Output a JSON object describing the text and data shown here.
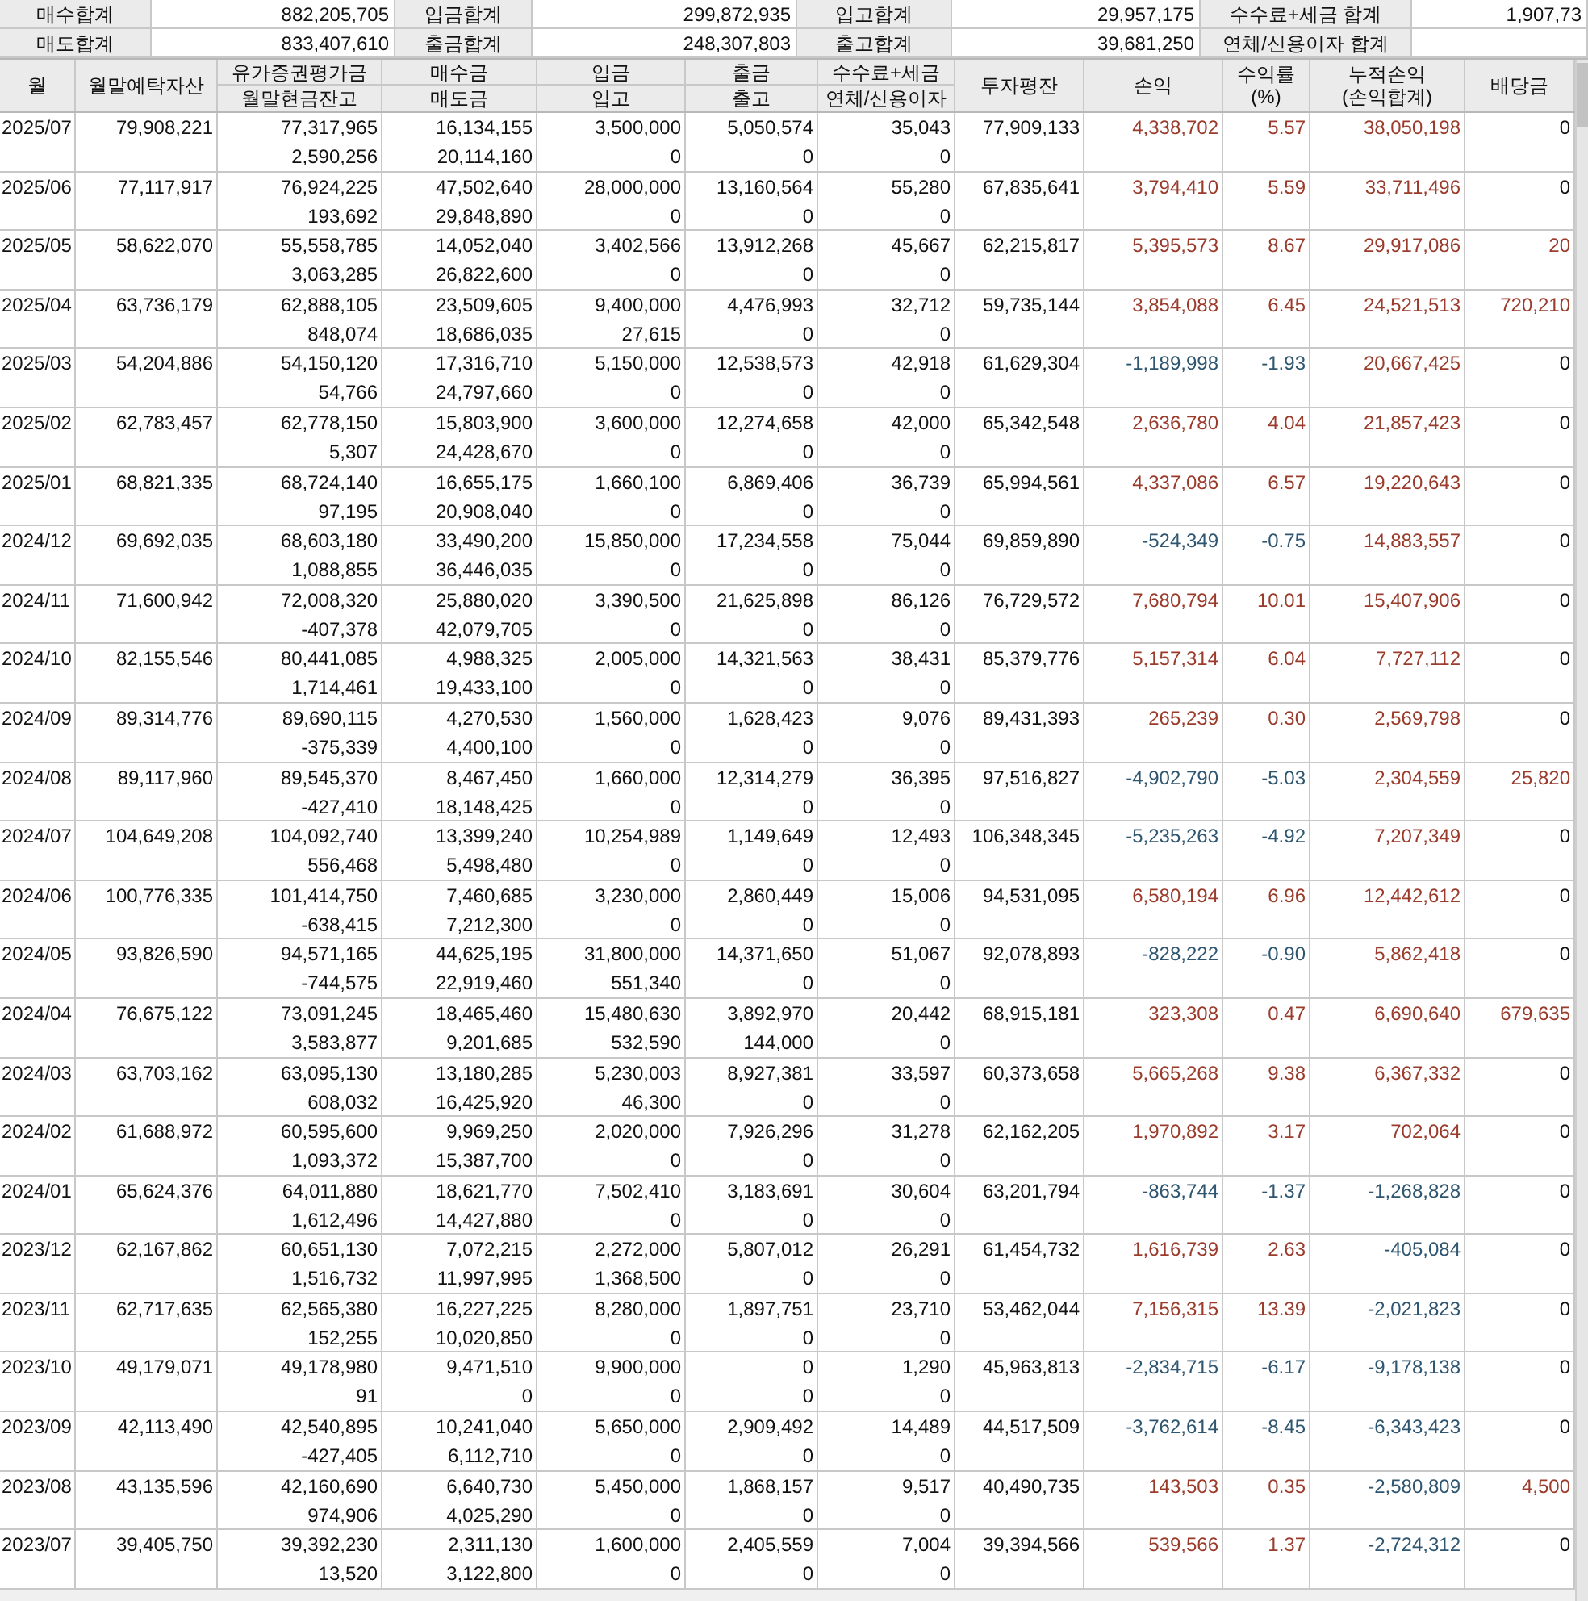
{
  "summary": [
    {
      "label": "매수합계",
      "value": "882,205,705"
    },
    {
      "label": "입금합계",
      "value": "299,872,935"
    },
    {
      "label": "입고합계",
      "value": "29,957,175"
    },
    {
      "label": "수수료+세금 합계",
      "value": "1,907,73"
    },
    {
      "label": "매도합계",
      "value": "833,407,610"
    },
    {
      "label": "출금합계",
      "value": "248,307,803"
    },
    {
      "label": "출고합계",
      "value": "39,681,250"
    },
    {
      "label": "연체/신용이자 합계"
    }
  ],
  "columns": [
    {
      "lines": [
        "월"
      ]
    },
    {
      "lines": [
        "월말예탁자산"
      ]
    },
    {
      "top": "유가증권평가금",
      "bottom": "월말현금잔고"
    },
    {
      "top": "매수금",
      "bottom": "매도금"
    },
    {
      "top": "입금",
      "bottom": "입고"
    },
    {
      "top": "출금",
      "bottom": "출고"
    },
    {
      "top": "수수료+세금",
      "bottom": "연체/신용이자"
    },
    {
      "lines": [
        "투자평잔"
      ]
    },
    {
      "lines": [
        "손익"
      ]
    },
    {
      "lines": [
        "수익률",
        "(%)"
      ]
    },
    {
      "lines": [
        "누적손익",
        "(손익합계)"
      ]
    },
    {
      "lines": [
        "배당금"
      ]
    }
  ],
  "rows": [
    {
      "month": "2025/07",
      "assets": "79,908,221",
      "eval": [
        "77,317,965",
        "2,590,256"
      ],
      "trade": [
        "16,134,155",
        "20,114,160"
      ],
      "deposit": [
        "3,500,000",
        "0"
      ],
      "withdraw": [
        "5,050,574",
        "0"
      ],
      "fees": [
        "35,043",
        "0"
      ],
      "avg_invested": "77,909,133",
      "profit": {
        "text": "4,338,702",
        "color": "#9a3b2b"
      },
      "return_pct": {
        "text": "5.57",
        "color": "#9a3b2b"
      },
      "cumulative": {
        "text": "38,050,198",
        "color": "#9a3b2b"
      },
      "dividend": {
        "text": "0",
        "color": "#111111"
      }
    },
    {
      "month": "2025/06",
      "assets": "77,117,917",
      "eval": [
        "76,924,225",
        "193,692"
      ],
      "trade": [
        "47,502,640",
        "29,848,890"
      ],
      "deposit": [
        "28,000,000",
        "0"
      ],
      "withdraw": [
        "13,160,564",
        "0"
      ],
      "fees": [
        "55,280",
        "0"
      ],
      "avg_invested": "67,835,641",
      "profit": {
        "text": "3,794,410",
        "color": "#9a3b2b"
      },
      "return_pct": {
        "text": "5.59",
        "color": "#9a3b2b"
      },
      "cumulative": {
        "text": "33,711,496",
        "color": "#9a3b2b"
      },
      "dividend": {
        "text": "0",
        "color": "#111111"
      }
    },
    {
      "month": "2025/05",
      "assets": "58,622,070",
      "eval": [
        "55,558,785",
        "3,063,285"
      ],
      "trade": [
        "14,052,040",
        "26,822,600"
      ],
      "deposit": [
        "3,402,566",
        "0"
      ],
      "withdraw": [
        "13,912,268",
        "0"
      ],
      "fees": [
        "45,667",
        "0"
      ],
      "avg_invested": "62,215,817",
      "profit": {
        "text": "5,395,573",
        "color": "#9a3b2b"
      },
      "return_pct": {
        "text": "8.67",
        "color": "#9a3b2b"
      },
      "cumulative": {
        "text": "29,917,086",
        "color": "#9a3b2b"
      },
      "dividend": {
        "text": "20",
        "color": "#9a3b2b"
      }
    },
    {
      "month": "2025/04",
      "assets": "63,736,179",
      "eval": [
        "62,888,105",
        "848,074"
      ],
      "trade": [
        "23,509,605",
        "18,686,035"
      ],
      "deposit": [
        "9,400,000",
        "27,615"
      ],
      "withdraw": [
        "4,476,993",
        "0"
      ],
      "fees": [
        "32,712",
        "0"
      ],
      "avg_invested": "59,735,144",
      "profit": {
        "text": "3,854,088",
        "color": "#9a3b2b"
      },
      "return_pct": {
        "text": "6.45",
        "color": "#9a3b2b"
      },
      "cumulative": {
        "text": "24,521,513",
        "color": "#9a3b2b"
      },
      "dividend": {
        "text": "720,210",
        "color": "#9a3b2b"
      }
    },
    {
      "month": "2025/03",
      "assets": "54,204,886",
      "eval": [
        "54,150,120",
        "54,766"
      ],
      "trade": [
        "17,316,710",
        "24,797,660"
      ],
      "deposit": [
        "5,150,000",
        "0"
      ],
      "withdraw": [
        "12,538,573",
        "0"
      ],
      "fees": [
        "42,918",
        "0"
      ],
      "avg_invested": "61,629,304",
      "profit": {
        "text": "-1,189,998",
        "color": "#2f5670"
      },
      "return_pct": {
        "text": "-1.93",
        "color": "#2f5670"
      },
      "cumulative": {
        "text": "20,667,425",
        "color": "#9a3b2b"
      },
      "dividend": {
        "text": "0",
        "color": "#111111"
      }
    },
    {
      "month": "2025/02",
      "assets": "62,783,457",
      "eval": [
        "62,778,150",
        "5,307"
      ],
      "trade": [
        "15,803,900",
        "24,428,670"
      ],
      "deposit": [
        "3,600,000",
        "0"
      ],
      "withdraw": [
        "12,274,658",
        "0"
      ],
      "fees": [
        "42,000",
        "0"
      ],
      "avg_invested": "65,342,548",
      "profit": {
        "text": "2,636,780",
        "color": "#9a3b2b"
      },
      "return_pct": {
        "text": "4.04",
        "color": "#9a3b2b"
      },
      "cumulative": {
        "text": "21,857,423",
        "color": "#9a3b2b"
      },
      "dividend": {
        "text": "0",
        "color": "#111111"
      }
    },
    {
      "month": "2025/01",
      "assets": "68,821,335",
      "eval": [
        "68,724,140",
        "97,195"
      ],
      "trade": [
        "16,655,175",
        "20,908,040"
      ],
      "deposit": [
        "1,660,100",
        "0"
      ],
      "withdraw": [
        "6,869,406",
        "0"
      ],
      "fees": [
        "36,739",
        "0"
      ],
      "avg_invested": "65,994,561",
      "profit": {
        "text": "4,337,086",
        "color": "#9a3b2b"
      },
      "return_pct": {
        "text": "6.57",
        "color": "#9a3b2b"
      },
      "cumulative": {
        "text": "19,220,643",
        "color": "#9a3b2b"
      },
      "dividend": {
        "text": "0",
        "color": "#111111"
      }
    },
    {
      "month": "2024/12",
      "assets": "69,692,035",
      "eval": [
        "68,603,180",
        "1,088,855"
      ],
      "trade": [
        "33,490,200",
        "36,446,035"
      ],
      "deposit": [
        "15,850,000",
        "0"
      ],
      "withdraw": [
        "17,234,558",
        "0"
      ],
      "fees": [
        "75,044",
        "0"
      ],
      "avg_invested": "69,859,890",
      "profit": {
        "text": "-524,349",
        "color": "#2f5670"
      },
      "return_pct": {
        "text": "-0.75",
        "color": "#2f5670"
      },
      "cumulative": {
        "text": "14,883,557",
        "color": "#9a3b2b"
      },
      "dividend": {
        "text": "0",
        "color": "#111111"
      }
    },
    {
      "month": "2024/11",
      "assets": "71,600,942",
      "eval": [
        "72,008,320",
        "-407,378"
      ],
      "trade": [
        "25,880,020",
        "42,079,705"
      ],
      "deposit": [
        "3,390,500",
        "0"
      ],
      "withdraw": [
        "21,625,898",
        "0"
      ],
      "fees": [
        "86,126",
        "0"
      ],
      "avg_invested": "76,729,572",
      "profit": {
        "text": "7,680,794",
        "color": "#9a3b2b"
      },
      "return_pct": {
        "text": "10.01",
        "color": "#9a3b2b"
      },
      "cumulative": {
        "text": "15,407,906",
        "color": "#9a3b2b"
      },
      "dividend": {
        "text": "0",
        "color": "#111111"
      }
    },
    {
      "month": "2024/10",
      "assets": "82,155,546",
      "eval": [
        "80,441,085",
        "1,714,461"
      ],
      "trade": [
        "4,988,325",
        "19,433,100"
      ],
      "deposit": [
        "2,005,000",
        "0"
      ],
      "withdraw": [
        "14,321,563",
        "0"
      ],
      "fees": [
        "38,431",
        "0"
      ],
      "avg_invested": "85,379,776",
      "profit": {
        "text": "5,157,314",
        "color": "#9a3b2b"
      },
      "return_pct": {
        "text": "6.04",
        "color": "#9a3b2b"
      },
      "cumulative": {
        "text": "7,727,112",
        "color": "#9a3b2b"
      },
      "dividend": {
        "text": "0",
        "color": "#111111"
      }
    },
    {
      "month": "2024/09",
      "assets": "89,314,776",
      "eval": [
        "89,690,115",
        "-375,339"
      ],
      "trade": [
        "4,270,530",
        "4,400,100"
      ],
      "deposit": [
        "1,560,000",
        "0"
      ],
      "withdraw": [
        "1,628,423",
        "0"
      ],
      "fees": [
        "9,076",
        "0"
      ],
      "avg_invested": "89,431,393",
      "profit": {
        "text": "265,239",
        "color": "#9a3b2b"
      },
      "return_pct": {
        "text": "0.30",
        "color": "#9a3b2b"
      },
      "cumulative": {
        "text": "2,569,798",
        "color": "#9a3b2b"
      },
      "dividend": {
        "text": "0",
        "color": "#111111"
      }
    },
    {
      "month": "2024/08",
      "assets": "89,117,960",
      "eval": [
        "89,545,370",
        "-427,410"
      ],
      "trade": [
        "8,467,450",
        "18,148,425"
      ],
      "deposit": [
        "1,660,000",
        "0"
      ],
      "withdraw": [
        "12,314,279",
        "0"
      ],
      "fees": [
        "36,395",
        "0"
      ],
      "avg_invested": "97,516,827",
      "profit": {
        "text": "-4,902,790",
        "color": "#2f5670"
      },
      "return_pct": {
        "text": "-5.03",
        "color": "#2f5670"
      },
      "cumulative": {
        "text": "2,304,559",
        "color": "#9a3b2b"
      },
      "dividend": {
        "text": "25,820",
        "color": "#9a3b2b"
      }
    },
    {
      "month": "2024/07",
      "assets": "104,649,208",
      "eval": [
        "104,092,740",
        "556,468"
      ],
      "trade": [
        "13,399,240",
        "5,498,480"
      ],
      "deposit": [
        "10,254,989",
        "0"
      ],
      "withdraw": [
        "1,149,649",
        "0"
      ],
      "fees": [
        "12,493",
        "0"
      ],
      "avg_invested": "106,348,345",
      "profit": {
        "text": "-5,235,263",
        "color": "#2f5670"
      },
      "return_pct": {
        "text": "-4.92",
        "color": "#2f5670"
      },
      "cumulative": {
        "text": "7,207,349",
        "color": "#9a3b2b"
      },
      "dividend": {
        "text": "0",
        "color": "#111111"
      }
    },
    {
      "month": "2024/06",
      "assets": "100,776,335",
      "eval": [
        "101,414,750",
        "-638,415"
      ],
      "trade": [
        "7,460,685",
        "7,212,300"
      ],
      "deposit": [
        "3,230,000",
        "0"
      ],
      "withdraw": [
        "2,860,449",
        "0"
      ],
      "fees": [
        "15,006",
        "0"
      ],
      "avg_invested": "94,531,095",
      "profit": {
        "text": "6,580,194",
        "color": "#9a3b2b"
      },
      "return_pct": {
        "text": "6.96",
        "color": "#9a3b2b"
      },
      "cumulative": {
        "text": "12,442,612",
        "color": "#9a3b2b"
      },
      "dividend": {
        "text": "0",
        "color": "#111111"
      }
    },
    {
      "month": "2024/05",
      "assets": "93,826,590",
      "eval": [
        "94,571,165",
        "-744,575"
      ],
      "trade": [
        "44,625,195",
        "22,919,460"
      ],
      "deposit": [
        "31,800,000",
        "551,340"
      ],
      "withdraw": [
        "14,371,650",
        "0"
      ],
      "fees": [
        "51,067",
        "0"
      ],
      "avg_invested": "92,078,893",
      "profit": {
        "text": "-828,222",
        "color": "#2f5670"
      },
      "return_pct": {
        "text": "-0.90",
        "color": "#2f5670"
      },
      "cumulative": {
        "text": "5,862,418",
        "color": "#9a3b2b"
      },
      "dividend": {
        "text": "0",
        "color": "#111111"
      }
    },
    {
      "month": "2024/04",
      "assets": "76,675,122",
      "eval": [
        "73,091,245",
        "3,583,877"
      ],
      "trade": [
        "18,465,460",
        "9,201,685"
      ],
      "deposit": [
        "15,480,630",
        "532,590"
      ],
      "withdraw": [
        "3,892,970",
        "144,000"
      ],
      "fees": [
        "20,442",
        "0"
      ],
      "avg_invested": "68,915,181",
      "profit": {
        "text": "323,308",
        "color": "#9a3b2b"
      },
      "return_pct": {
        "text": "0.47",
        "color": "#9a3b2b"
      },
      "cumulative": {
        "text": "6,690,640",
        "color": "#9a3b2b"
      },
      "dividend": {
        "text": "679,635",
        "color": "#9a3b2b"
      }
    },
    {
      "month": "2024/03",
      "assets": "63,703,162",
      "eval": [
        "63,095,130",
        "608,032"
      ],
      "trade": [
        "13,180,285",
        "16,425,920"
      ],
      "deposit": [
        "5,230,003",
        "46,300"
      ],
      "withdraw": [
        "8,927,381",
        "0"
      ],
      "fees": [
        "33,597",
        "0"
      ],
      "avg_invested": "60,373,658",
      "profit": {
        "text": "5,665,268",
        "color": "#9a3b2b"
      },
      "return_pct": {
        "text": "9.38",
        "color": "#9a3b2b"
      },
      "cumulative": {
        "text": "6,367,332",
        "color": "#9a3b2b"
      },
      "dividend": {
        "text": "0",
        "color": "#111111"
      }
    },
    {
      "month": "2024/02",
      "assets": "61,688,972",
      "eval": [
        "60,595,600",
        "1,093,372"
      ],
      "trade": [
        "9,969,250",
        "15,387,700"
      ],
      "deposit": [
        "2,020,000",
        "0"
      ],
      "withdraw": [
        "7,926,296",
        "0"
      ],
      "fees": [
        "31,278",
        "0"
      ],
      "avg_invested": "62,162,205",
      "profit": {
        "text": "1,970,892",
        "color": "#9a3b2b"
      },
      "return_pct": {
        "text": "3.17",
        "color": "#9a3b2b"
      },
      "cumulative": {
        "text": "702,064",
        "color": "#9a3b2b"
      },
      "dividend": {
        "text": "0",
        "color": "#111111"
      }
    },
    {
      "month": "2024/01",
      "assets": "65,624,376",
      "eval": [
        "64,011,880",
        "1,612,496"
      ],
      "trade": [
        "18,621,770",
        "14,427,880"
      ],
      "deposit": [
        "7,502,410",
        "0"
      ],
      "withdraw": [
        "3,183,691",
        "0"
      ],
      "fees": [
        "30,604",
        "0"
      ],
      "avg_invested": "63,201,794",
      "profit": {
        "text": "-863,744",
        "color": "#2f5670"
      },
      "return_pct": {
        "text": "-1.37",
        "color": "#2f5670"
      },
      "cumulative": {
        "text": "-1,268,828",
        "color": "#2f5670"
      },
      "dividend": {
        "text": "0",
        "color": "#111111"
      }
    },
    {
      "month": "2023/12",
      "assets": "62,167,862",
      "eval": [
        "60,651,130",
        "1,516,732"
      ],
      "trade": [
        "7,072,215",
        "11,997,995"
      ],
      "deposit": [
        "2,272,000",
        "1,368,500"
      ],
      "withdraw": [
        "5,807,012",
        "0"
      ],
      "fees": [
        "26,291",
        "0"
      ],
      "avg_invested": "61,454,732",
      "profit": {
        "text": "1,616,739",
        "color": "#9a3b2b"
      },
      "return_pct": {
        "text": "2.63",
        "color": "#9a3b2b"
      },
      "cumulative": {
        "text": "-405,084",
        "color": "#2f5670"
      },
      "dividend": {
        "text": "0",
        "color": "#111111"
      }
    },
    {
      "month": "2023/11",
      "assets": "62,717,635",
      "eval": [
        "62,565,380",
        "152,255"
      ],
      "trade": [
        "16,227,225",
        "10,020,850"
      ],
      "deposit": [
        "8,280,000",
        "0"
      ],
      "withdraw": [
        "1,897,751",
        "0"
      ],
      "fees": [
        "23,710",
        "0"
      ],
      "avg_invested": "53,462,044",
      "profit": {
        "text": "7,156,315",
        "color": "#9a3b2b"
      },
      "return_pct": {
        "text": "13.39",
        "color": "#9a3b2b"
      },
      "cumulative": {
        "text": "-2,021,823",
        "color": "#2f5670"
      },
      "dividend": {
        "text": "0",
        "color": "#111111"
      }
    },
    {
      "month": "2023/10",
      "assets": "49,179,071",
      "eval": [
        "49,178,980",
        "91"
      ],
      "trade": [
        "9,471,510",
        "0"
      ],
      "deposit": [
        "9,900,000",
        "0"
      ],
      "withdraw": [
        "0",
        "0"
      ],
      "fees": [
        "1,290",
        "0"
      ],
      "avg_invested": "45,963,813",
      "profit": {
        "text": "-2,834,715",
        "color": "#2f5670"
      },
      "return_pct": {
        "text": "-6.17",
        "color": "#2f5670"
      },
      "cumulative": {
        "text": "-9,178,138",
        "color": "#2f5670"
      },
      "dividend": {
        "text": "0",
        "color": "#111111"
      }
    },
    {
      "month": "2023/09",
      "assets": "42,113,490",
      "eval": [
        "42,540,895",
        "-427,405"
      ],
      "trade": [
        "10,241,040",
        "6,112,710"
      ],
      "deposit": [
        "5,650,000",
        "0"
      ],
      "withdraw": [
        "2,909,492",
        "0"
      ],
      "fees": [
        "14,489",
        "0"
      ],
      "avg_invested": "44,517,509",
      "profit": {
        "text": "-3,762,614",
        "color": "#2f5670"
      },
      "return_pct": {
        "text": "-8.45",
        "color": "#2f5670"
      },
      "cumulative": {
        "text": "-6,343,423",
        "color": "#2f5670"
      },
      "dividend": {
        "text": "0",
        "color": "#111111"
      }
    },
    {
      "month": "2023/08",
      "assets": "43,135,596",
      "eval": [
        "42,160,690",
        "974,906"
      ],
      "trade": [
        "6,640,730",
        "4,025,290"
      ],
      "deposit": [
        "5,450,000",
        "0"
      ],
      "withdraw": [
        "1,868,157",
        "0"
      ],
      "fees": [
        "9,517",
        "0"
      ],
      "avg_invested": "40,490,735",
      "profit": {
        "text": "143,503",
        "color": "#9a3b2b"
      },
      "return_pct": {
        "text": "0.35",
        "color": "#9a3b2b"
      },
      "cumulative": {
        "text": "-2,580,809",
        "color": "#2f5670"
      },
      "dividend": {
        "text": "4,500",
        "color": "#9a3b2b"
      }
    },
    {
      "month": "2023/07",
      "assets": "39,405,750",
      "eval": [
        "39,392,230",
        "13,520"
      ],
      "trade": [
        "2,311,130",
        "3,122,800"
      ],
      "deposit": [
        "1,600,000",
        "0"
      ],
      "withdraw": [
        "2,405,559",
        "0"
      ],
      "fees": [
        "7,004",
        "0"
      ],
      "avg_invested": "39,394,566",
      "profit": {
        "text": "539,566",
        "color": "#9a3b2b"
      },
      "return_pct": {
        "text": "1.37",
        "color": "#9a3b2b"
      },
      "cumulative": {
        "text": "-2,724,312",
        "color": "#2f5670"
      },
      "dividend": {
        "text": "0",
        "color": "#111111"
      }
    }
  ]
}
